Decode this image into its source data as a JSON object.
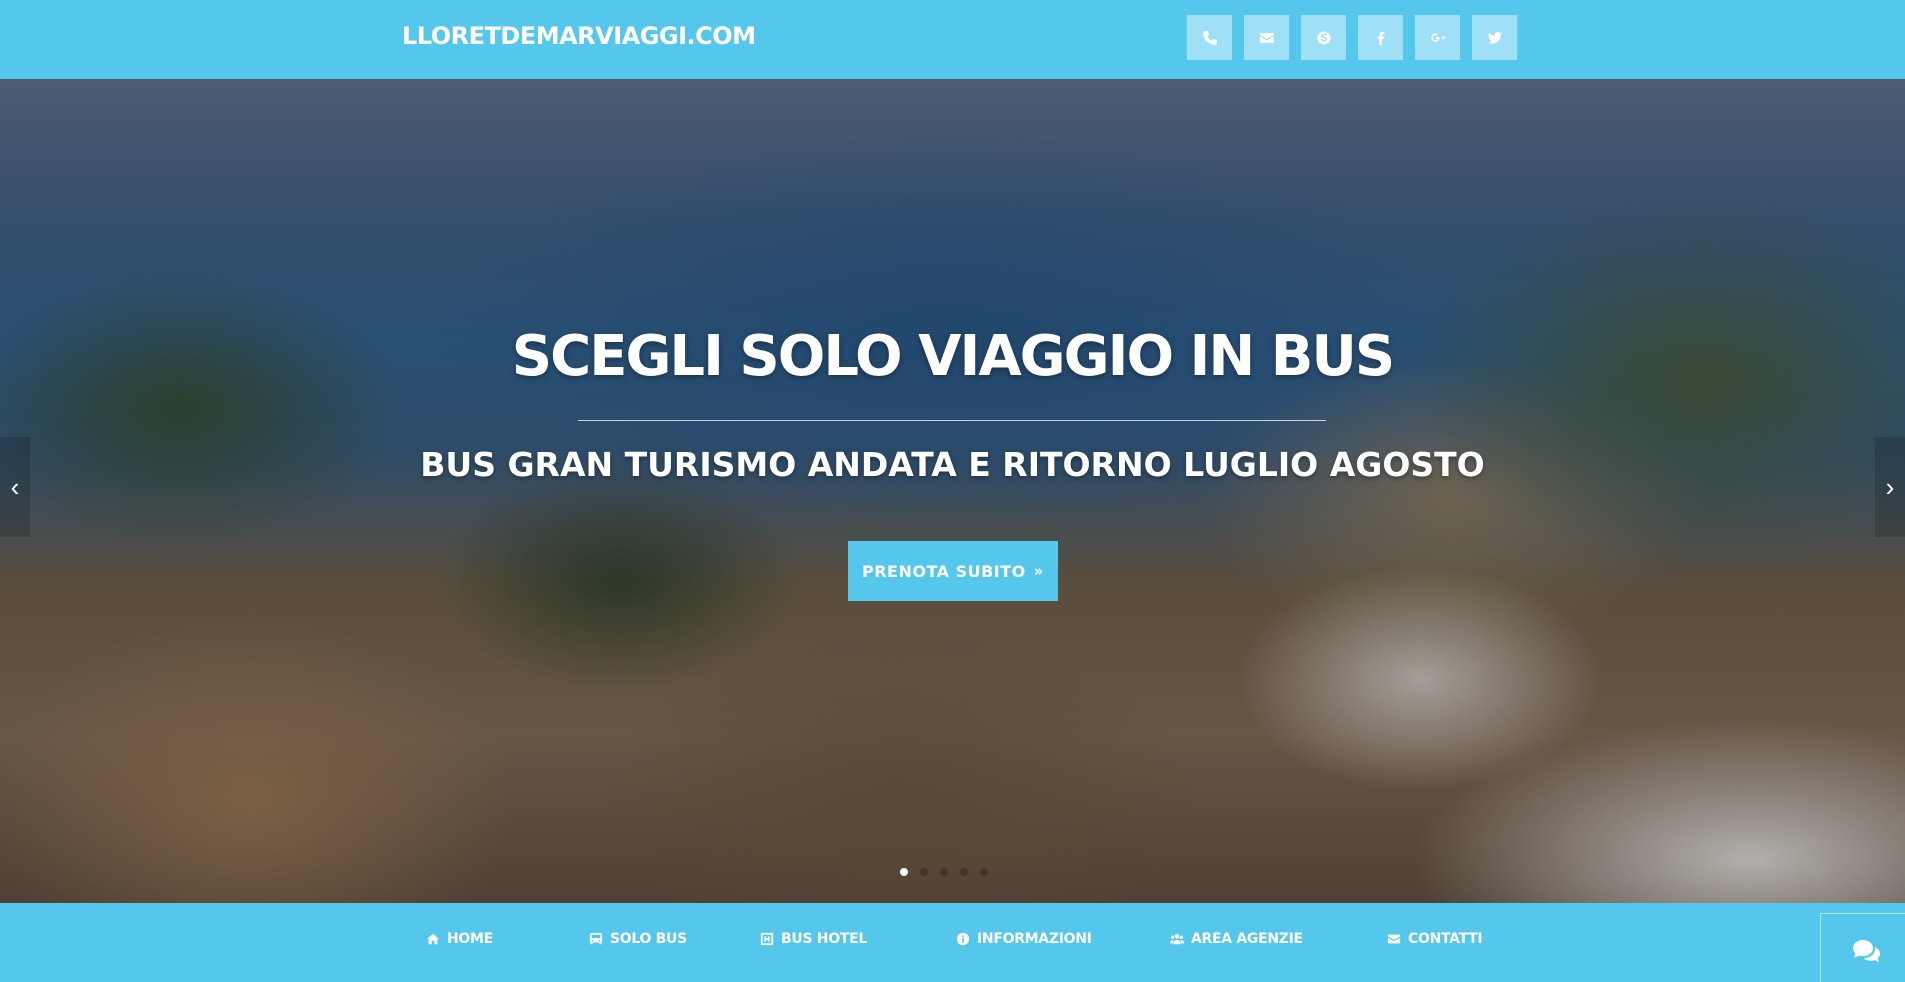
{
  "header": {
    "brand": "LLORETDEMARVIAGGI.COM",
    "social_icons": [
      "phone-icon",
      "envelope-icon",
      "skype-icon",
      "facebook-icon",
      "google-plus-icon",
      "twitter-icon"
    ]
  },
  "hero": {
    "headline": "SCEGLI SOLO VIAGGIO IN BUS",
    "subheadline": "BUS GRAN TURISMO ANDATA E RITORNO LUGLIO AGOSTO",
    "cta_label": "PRENOTA SUBITO",
    "slides_total": 5,
    "active_slide": 1
  },
  "nav": {
    "items": [
      {
        "label": "HOME",
        "icon": "home-icon"
      },
      {
        "label": "SOLO BUS",
        "icon": "bus-icon"
      },
      {
        "label": "BUS HOTEL",
        "icon": "hotel-icon"
      },
      {
        "label": "INFORMAZIONI",
        "icon": "info-icon"
      },
      {
        "label": "AREA AGENZIE",
        "icon": "users-icon"
      },
      {
        "label": "CONTATTI",
        "icon": "envelope-icon"
      }
    ]
  },
  "colors": {
    "brand": "#55c6ec",
    "social_button": "#9fe0f6"
  }
}
